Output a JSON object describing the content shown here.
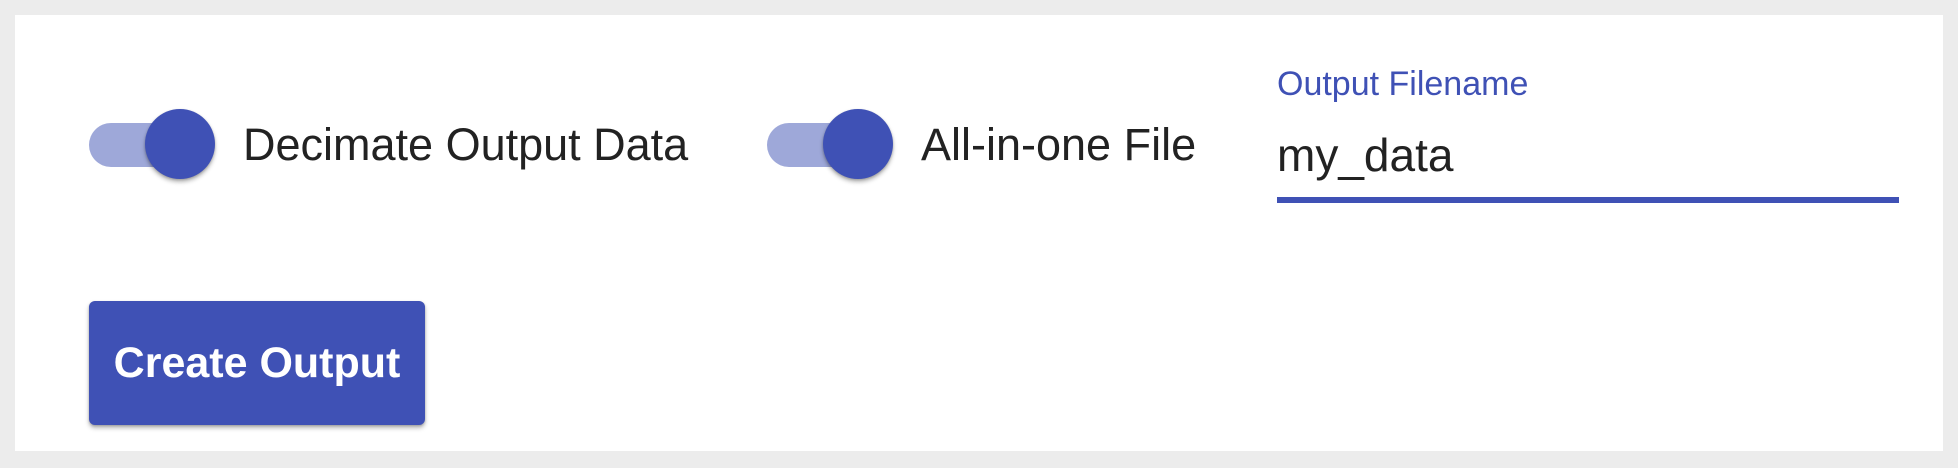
{
  "colors": {
    "accent": "#3f51b5",
    "track_on": "#9ea8d9",
    "text": "#222222",
    "page_background": "#ececec",
    "panel_background": "#ffffff"
  },
  "toggles": [
    {
      "label": "Decimate Output Data",
      "checked": true
    },
    {
      "label": "All-in-one File",
      "checked": true
    }
  ],
  "filename_field": {
    "label": "Output Filename",
    "value": "my_data"
  },
  "create_button": {
    "label": "Create Output"
  }
}
